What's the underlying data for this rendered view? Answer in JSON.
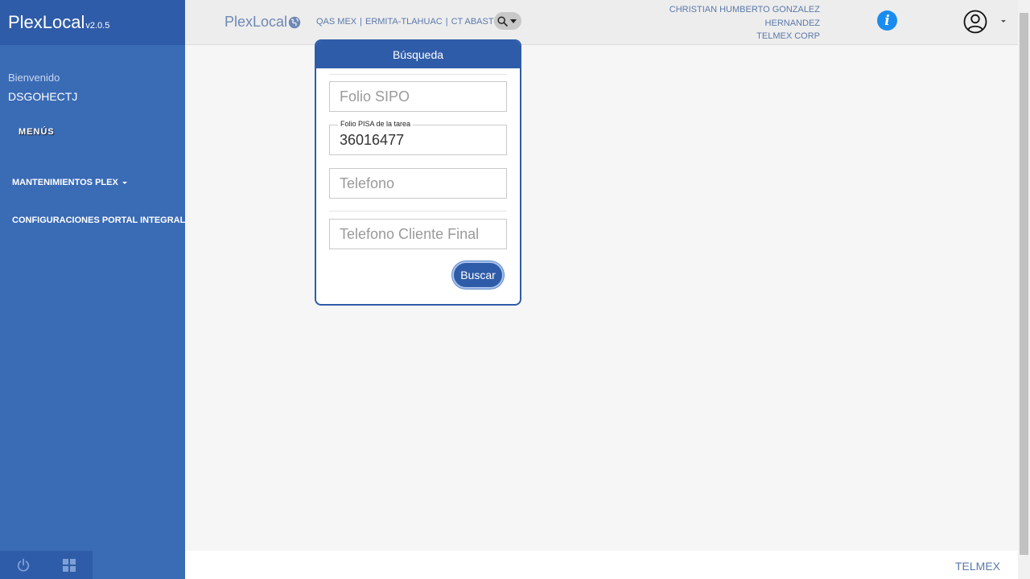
{
  "sidebar": {
    "brand_name": "PlexLocal",
    "brand_version": "v2.0.5",
    "welcome": "Bienvenido",
    "username": "DSGOHECTJ",
    "menus_label": "MENÚS",
    "items": [
      {
        "label": "MANTENIMIENTOS PLEX"
      },
      {
        "label": "CONFIGURACIONES PORTAL INTEGRAL"
      }
    ],
    "footer_icons": [
      "power-icon",
      "grid-icon"
    ]
  },
  "header": {
    "brand": "PlexLocal",
    "environment": "QAS MEX",
    "location": "ERMITA-TLAHUAC",
    "center": "CT ABASTOS",
    "user_line1": "CHRISTIAN HUMBERTO GONZALEZ",
    "user_line2": "HERNANDEZ",
    "company": "TELMEX CORP",
    "info_glyph": "i"
  },
  "search_card": {
    "title": "Búsqueda",
    "folio_sipo_placeholder": "Folio SIPO",
    "folio_pisa_label": "Folio PISA de la tarea",
    "folio_pisa_value": "36016477",
    "telefono_placeholder": "Telefono",
    "telefono_cliente_placeholder": "Telefono Cliente Final",
    "buscar_label": "Buscar"
  },
  "footer": {
    "text": "TELMEX"
  },
  "colors": {
    "sidebar": "#3a6bb5",
    "sidebar_dark": "#2f5ca8",
    "info_blue": "#1a8cf0",
    "link_text": "#5b79ab"
  }
}
